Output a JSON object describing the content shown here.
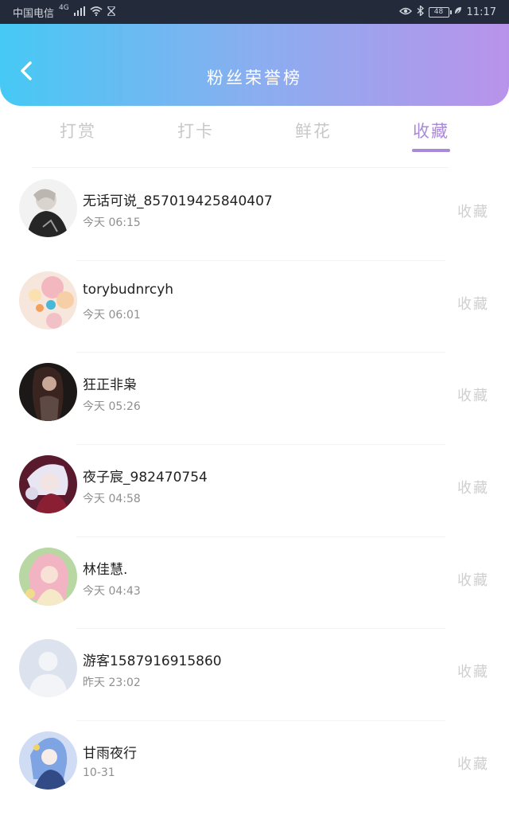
{
  "status_bar": {
    "carrier": "中国电信",
    "network": "4G",
    "battery": "48",
    "time": "11:17"
  },
  "header": {
    "title": "粉丝荣誉榜",
    "back_icon": "chevron-left-icon"
  },
  "tabs": [
    {
      "label": "打赏",
      "active": false
    },
    {
      "label": "打卡",
      "active": false
    },
    {
      "label": "鲜花",
      "active": false
    },
    {
      "label": "收藏",
      "active": true
    }
  ],
  "colors": {
    "header_gradient_start": "#46c9f4",
    "header_gradient_end": "#b993ea",
    "active_tab": "#a98ad8"
  },
  "rows": [
    {
      "name": "无话可说_857019425840407",
      "time": "今天 06:15",
      "action": "收藏"
    },
    {
      "name": "torybudnrcyh",
      "time": "今天 06:01",
      "action": "收藏"
    },
    {
      "name": "狂正非枭",
      "time": "今天 05:26",
      "action": "收藏"
    },
    {
      "name": "夜子宸_982470754",
      "time": "今天 04:58",
      "action": "收藏"
    },
    {
      "name": "林佳慧.",
      "time": "今天 04:43",
      "action": "收藏"
    },
    {
      "name": "游客1587916915860",
      "time": "昨天 23:02",
      "action": "收藏"
    },
    {
      "name": "甘雨夜行",
      "time": "10-31",
      "action": "收藏"
    }
  ]
}
